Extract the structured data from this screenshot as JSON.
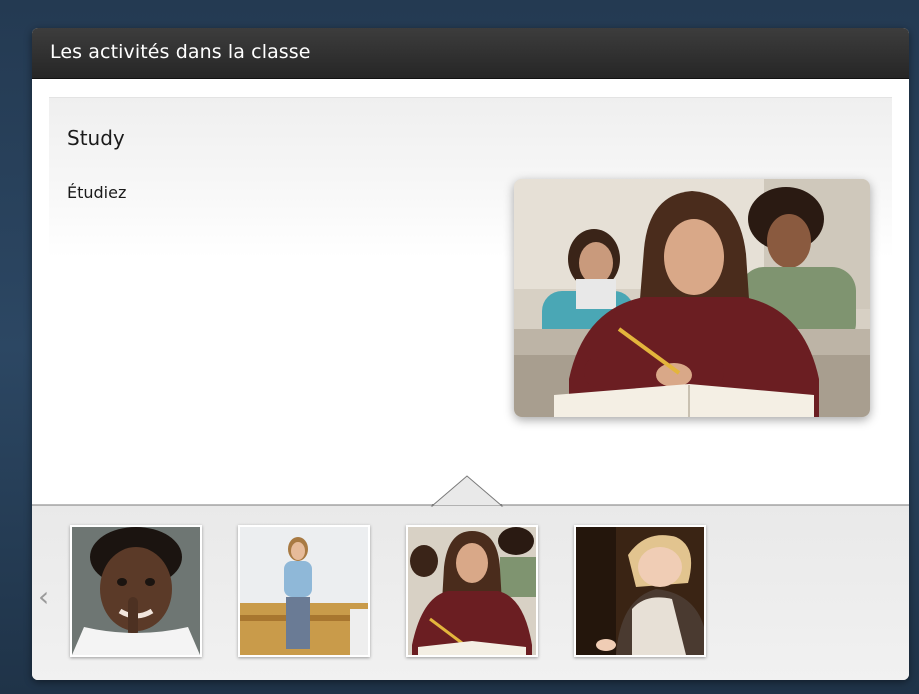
{
  "header": {
    "title": "Les activités dans la classe"
  },
  "card": {
    "word": "Study",
    "translation": "Étudiez"
  },
  "main_image": {
    "icon": "student-studying-photo"
  },
  "carousel": {
    "prev_icon": "‹",
    "thumbnails": [
      {
        "name": "quiet-gesture-photo"
      },
      {
        "name": "girl-at-whiteboard-photo"
      },
      {
        "name": "student-studying-photo",
        "selected": true
      },
      {
        "name": "girl-writing-photo"
      }
    ]
  },
  "colors": {
    "header_bg": "#2b2b2b",
    "background": "#243a52"
  }
}
